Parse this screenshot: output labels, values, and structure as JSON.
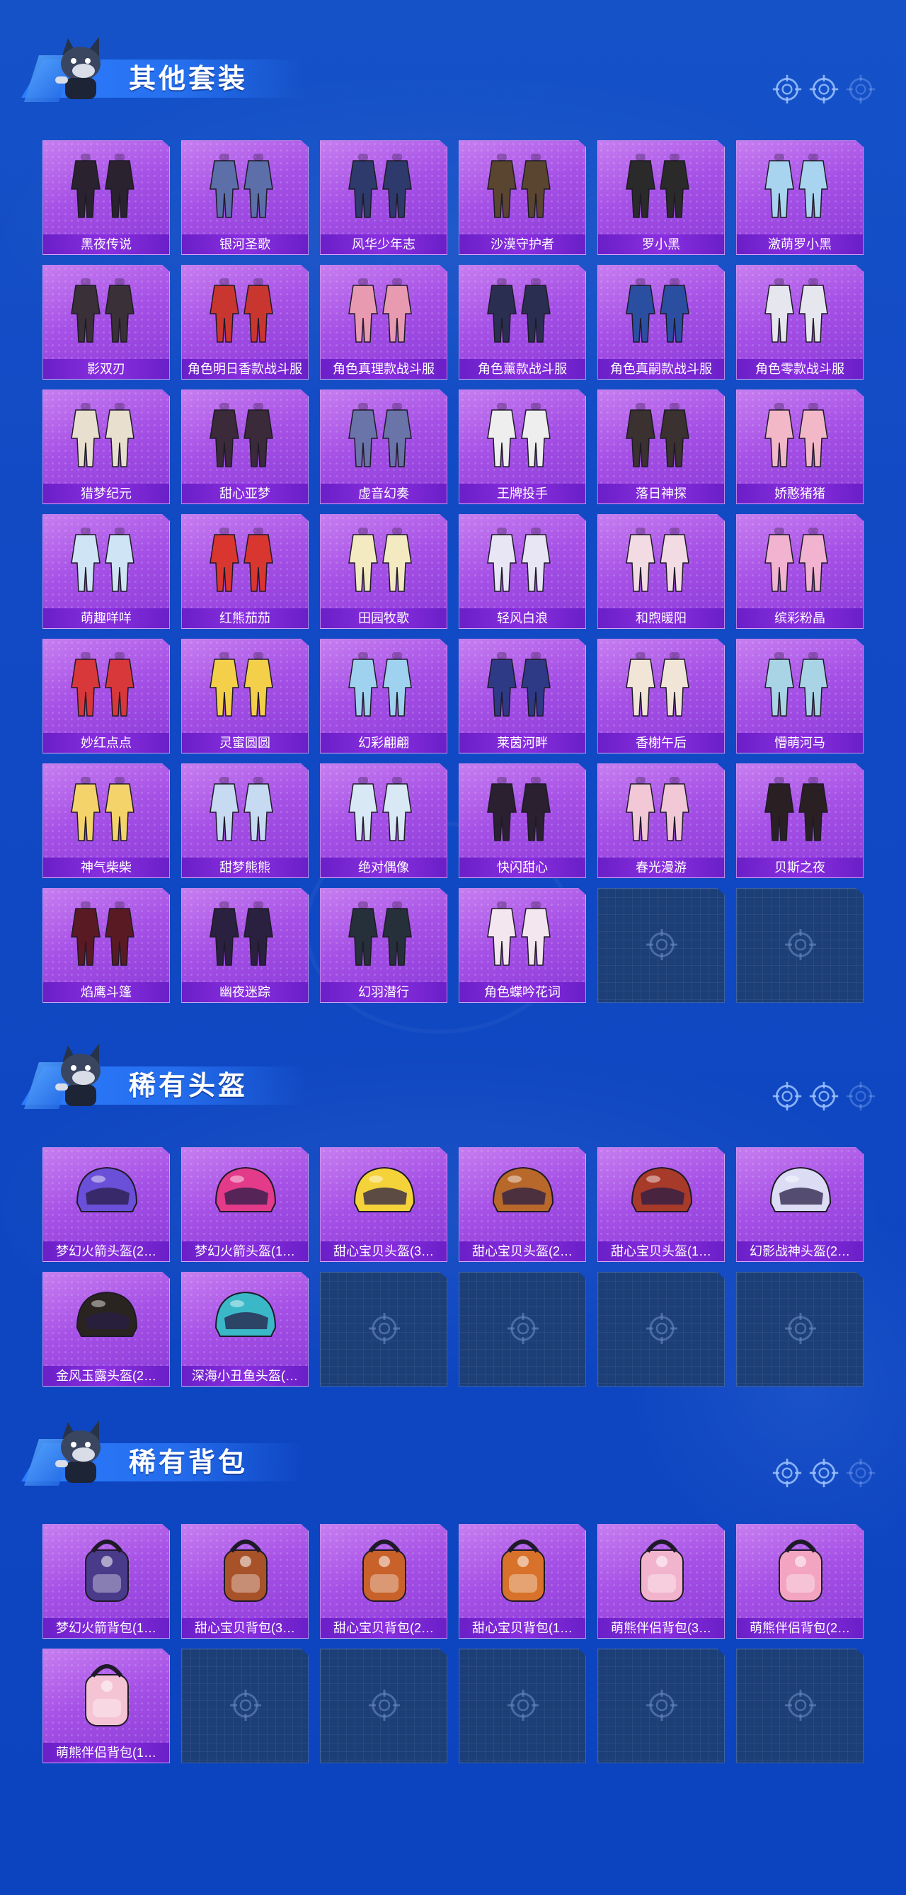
{
  "sections": [
    {
      "title": "其他套装",
      "items": [
        {
          "label": "黑夜传说",
          "icon": "outfit-dark-icon",
          "color": "#2b2230"
        },
        {
          "label": "银河圣歌",
          "icon": "outfit-robe-icon",
          "color": "#5c6fa8"
        },
        {
          "label": "风华少年志",
          "icon": "outfit-robe-icon",
          "color": "#2e3a6b"
        },
        {
          "label": "沙漠守护者",
          "icon": "outfit-armor-icon",
          "color": "#5a4630"
        },
        {
          "label": "罗小黑",
          "icon": "outfit-cat-icon",
          "color": "#2a2a2a"
        },
        {
          "label": "激萌罗小黑",
          "icon": "outfit-cat-icon",
          "color": "#a9d4ef"
        },
        {
          "label": "影双刃",
          "icon": "outfit-armor-icon",
          "color": "#3a3038"
        },
        {
          "label": "角色明日香款战斗服",
          "icon": "outfit-suit-icon",
          "color": "#c8362f"
        },
        {
          "label": "角色真理款战斗服",
          "icon": "outfit-suit-icon",
          "color": "#e89ab0"
        },
        {
          "label": "角色薰款战斗服",
          "icon": "outfit-suit-icon",
          "color": "#2a2f52"
        },
        {
          "label": "角色真嗣款战斗服",
          "icon": "outfit-suit-icon",
          "color": "#2b4fa0"
        },
        {
          "label": "角色零款战斗服",
          "icon": "outfit-suit-icon",
          "color": "#e6e6ee"
        },
        {
          "label": "猎梦纪元",
          "icon": "outfit-robe-icon",
          "color": "#e8dfcf"
        },
        {
          "label": "甜心亚梦",
          "icon": "outfit-dress-icon",
          "color": "#3a2a3a"
        },
        {
          "label": "虚音幻奏",
          "icon": "outfit-dress-icon",
          "color": "#6a74a8"
        },
        {
          "label": "王牌投手",
          "icon": "outfit-suit-icon",
          "color": "#eeeeee"
        },
        {
          "label": "落日神探",
          "icon": "outfit-armor-icon",
          "color": "#3a3130"
        },
        {
          "label": "娇憨猪猪",
          "icon": "outfit-dress-icon",
          "color": "#f2b8c8"
        },
        {
          "label": "萌趣咩咩",
          "icon": "outfit-dress-icon",
          "color": "#cfe4f4"
        },
        {
          "label": "红熊茄茄",
          "icon": "outfit-fruit-icon",
          "color": "#d8362f"
        },
        {
          "label": "田园牧歌",
          "icon": "outfit-dress-icon",
          "color": "#f3eac2"
        },
        {
          "label": "轻风白浪",
          "icon": "outfit-dress-icon",
          "color": "#e8e6f4"
        },
        {
          "label": "和煦暖阳",
          "icon": "outfit-dress-icon",
          "color": "#f2dbe2"
        },
        {
          "label": "缤彩粉晶",
          "icon": "outfit-dress-icon",
          "color": "#f1b3cf"
        },
        {
          "label": "妙红点点",
          "icon": "outfit-dress-icon",
          "color": "#d8383a"
        },
        {
          "label": "灵蜜圆圆",
          "icon": "outfit-dress-icon",
          "color": "#f3cf4a"
        },
        {
          "label": "幻彩翩翩",
          "icon": "outfit-dress-icon",
          "color": "#9fd2ee"
        },
        {
          "label": "莱茵河畔",
          "icon": "outfit-suit-icon",
          "color": "#2e3a86"
        },
        {
          "label": "香榭午后",
          "icon": "outfit-dress-icon",
          "color": "#f1e5d8"
        },
        {
          "label": "懵萌河马",
          "icon": "outfit-dress-icon",
          "color": "#a8d4e6"
        },
        {
          "label": "神气柴柴",
          "icon": "outfit-dress-icon",
          "color": "#f4d46a"
        },
        {
          "label": "甜梦熊熊",
          "icon": "outfit-dress-icon",
          "color": "#c6daf2"
        },
        {
          "label": "绝对偶像",
          "icon": "outfit-dress-icon",
          "color": "#d8e8f4"
        },
        {
          "label": "快闪甜心",
          "icon": "outfit-dress-icon",
          "color": "#2a2030"
        },
        {
          "label": "春光漫游",
          "icon": "outfit-dress-icon",
          "color": "#f2c8d6"
        },
        {
          "label": "贝斯之夜",
          "icon": "outfit-dress-icon",
          "color": "#2a2024"
        },
        {
          "label": "焰鹰斗篷",
          "icon": "outfit-cloak-icon",
          "color": "#5a1a24"
        },
        {
          "label": "幽夜迷踪",
          "icon": "outfit-cloak-icon",
          "color": "#2a2040"
        },
        {
          "label": "幻羽潜行",
          "icon": "outfit-cloak-icon",
          "color": "#26303a"
        },
        {
          "label": "角色蝶吟花词",
          "icon": "outfit-dress-icon",
          "color": "#f4e6ee"
        },
        {
          "label": "",
          "icon": "empty-slot-icon",
          "color": ""
        },
        {
          "label": "",
          "icon": "empty-slot-icon",
          "color": ""
        }
      ]
    },
    {
      "title": "稀有头盔",
      "items": [
        {
          "label": "梦幻火箭头盔(2…",
          "icon": "helmet-icon",
          "color": "#6a4fd8"
        },
        {
          "label": "梦幻火箭头盔(1…",
          "icon": "helmet-icon",
          "color": "#e33a8a"
        },
        {
          "label": "甜心宝贝头盔(3…",
          "icon": "helmet-icon",
          "color": "#f4d23a"
        },
        {
          "label": "甜心宝贝头盔(2…",
          "icon": "helmet-icon",
          "color": "#b8682a"
        },
        {
          "label": "甜心宝贝头盔(1…",
          "icon": "helmet-icon",
          "color": "#a83a2a"
        },
        {
          "label": "幻影战神头盔(2…",
          "icon": "helmet-icon",
          "color": "#dcdcf4"
        },
        {
          "label": "金风玉露头盔(2…",
          "icon": "helmet-icon",
          "color": "#2a2420"
        },
        {
          "label": "深海小丑鱼头盔(…",
          "icon": "helmet-icon",
          "color": "#3ab8c8"
        },
        {
          "label": "",
          "icon": "empty-slot-icon",
          "color": ""
        },
        {
          "label": "",
          "icon": "empty-slot-icon",
          "color": ""
        },
        {
          "label": "",
          "icon": "empty-slot-icon",
          "color": ""
        },
        {
          "label": "",
          "icon": "empty-slot-icon",
          "color": ""
        }
      ]
    },
    {
      "title": "稀有背包",
      "items": [
        {
          "label": "梦幻火箭背包(1…",
          "icon": "backpack-icon",
          "color": "#4a3a8a"
        },
        {
          "label": "甜心宝贝背包(3…",
          "icon": "backpack-icon",
          "color": "#a8522a"
        },
        {
          "label": "甜心宝贝背包(2…",
          "icon": "backpack-icon",
          "color": "#c8622a"
        },
        {
          "label": "甜心宝贝背包(1…",
          "icon": "backpack-icon",
          "color": "#d8722a"
        },
        {
          "label": "萌熊伴侣背包(3…",
          "icon": "backpack-icon",
          "color": "#f2b4cc"
        },
        {
          "label": "萌熊伴侣背包(2…",
          "icon": "backpack-icon",
          "color": "#f2a4c0"
        },
        {
          "label": "萌熊伴侣背包(1…",
          "icon": "backpack-icon",
          "color": "#f4c4d4"
        },
        {
          "label": "",
          "icon": "empty-slot-icon",
          "color": ""
        },
        {
          "label": "",
          "icon": "empty-slot-icon",
          "color": ""
        },
        {
          "label": "",
          "icon": "empty-slot-icon",
          "color": ""
        },
        {
          "label": "",
          "icon": "empty-slot-icon",
          "color": ""
        },
        {
          "label": "",
          "icon": "empty-slot-icon",
          "color": ""
        }
      ]
    }
  ],
  "pager_icon": "crosshair-icon",
  "mascot_icon": "wolf-mascot-icon",
  "colors": {
    "background": "#1250c6",
    "card": "#a651e6",
    "card_label": "#7a28d4",
    "empty_slot": "#1d3f78",
    "banner": "#2d7dff"
  }
}
